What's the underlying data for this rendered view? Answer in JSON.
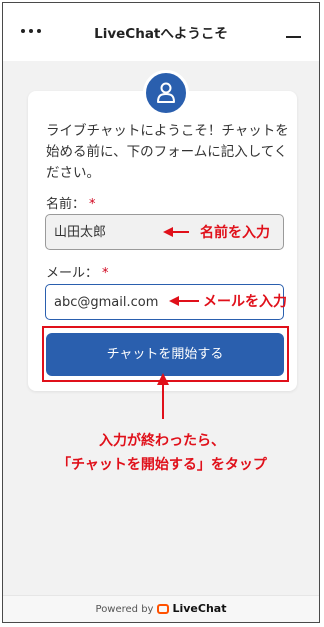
{
  "header": {
    "title": "LiveChatへようこそ",
    "menu_icon": "more-dots-icon",
    "minimize_icon": "minimize-icon"
  },
  "form": {
    "intro": "ライブチャットにようこそ！チャットを始める前に、下のフォームに記入してください。",
    "name_label": "名前：",
    "name_required": "*",
    "name_value": "山田太郎",
    "email_label": "メール：",
    "email_required": "*",
    "email_value": "abc@gmail.com",
    "start_button": "チャットを開始する"
  },
  "annotations": {
    "name_hint": "名前を入力",
    "email_hint": "メールを入力",
    "callout_line1": "入力が終わったら、",
    "callout_line2": "「チャットを開始する」をタップ"
  },
  "footer": {
    "powered_by": "Powered by",
    "brand": "LiveChat"
  },
  "colors": {
    "accent": "#2a5fae",
    "annotation": "#e0101a",
    "brand_logo": "#ff5100"
  }
}
